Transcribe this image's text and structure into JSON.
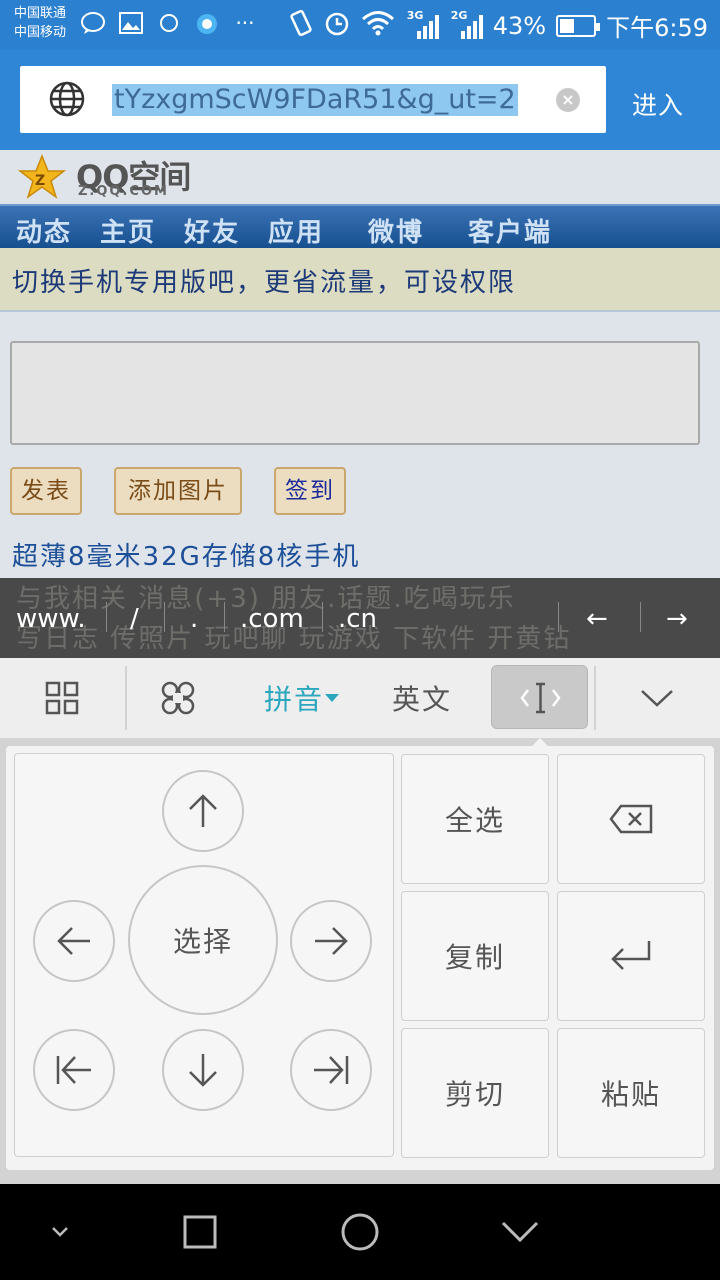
{
  "status_bar": {
    "carrier_1": "中国联通",
    "carrier_2": "中国移动",
    "net_1": "3G",
    "net_2": "2G",
    "battery": "43%",
    "battery_level": 0.43,
    "time": "下午6:59",
    "more": "···"
  },
  "browser": {
    "url": "tYzxgmScW9FDaR51&g_ut=2",
    "clear": "×",
    "go_label": "进入"
  },
  "page": {
    "logo_text": "QQ空间",
    "logo_sub": "Z.QQ.COM",
    "nav": [
      "动态",
      "主页",
      "好友",
      "应用",
      "微博",
      "客户端"
    ],
    "banner": "切换手机专用版吧，更省流量，可设权限",
    "buttons": {
      "publish": "发表",
      "add_image": "添加图片",
      "checkin": "签到"
    },
    "promo": "超薄8毫米32G存储8核手机",
    "faint_line_1": "与我相关 消息(+3) 朋友.话题.吃喝玩乐",
    "faint_line_2": "写日志 传照片 玩吧聊 玩游戏 下软件 开黄钻"
  },
  "shortcuts": {
    "items": [
      "www.",
      "/",
      ".",
      ".com",
      ".cn"
    ],
    "left_arrow": "←",
    "right_arrow": "→"
  },
  "keyboard": {
    "pinyin": "拼音",
    "english": "英文",
    "select": "选择",
    "select_all": "全选",
    "copy": "复制",
    "cut": "剪切",
    "paste": "粘贴"
  }
}
